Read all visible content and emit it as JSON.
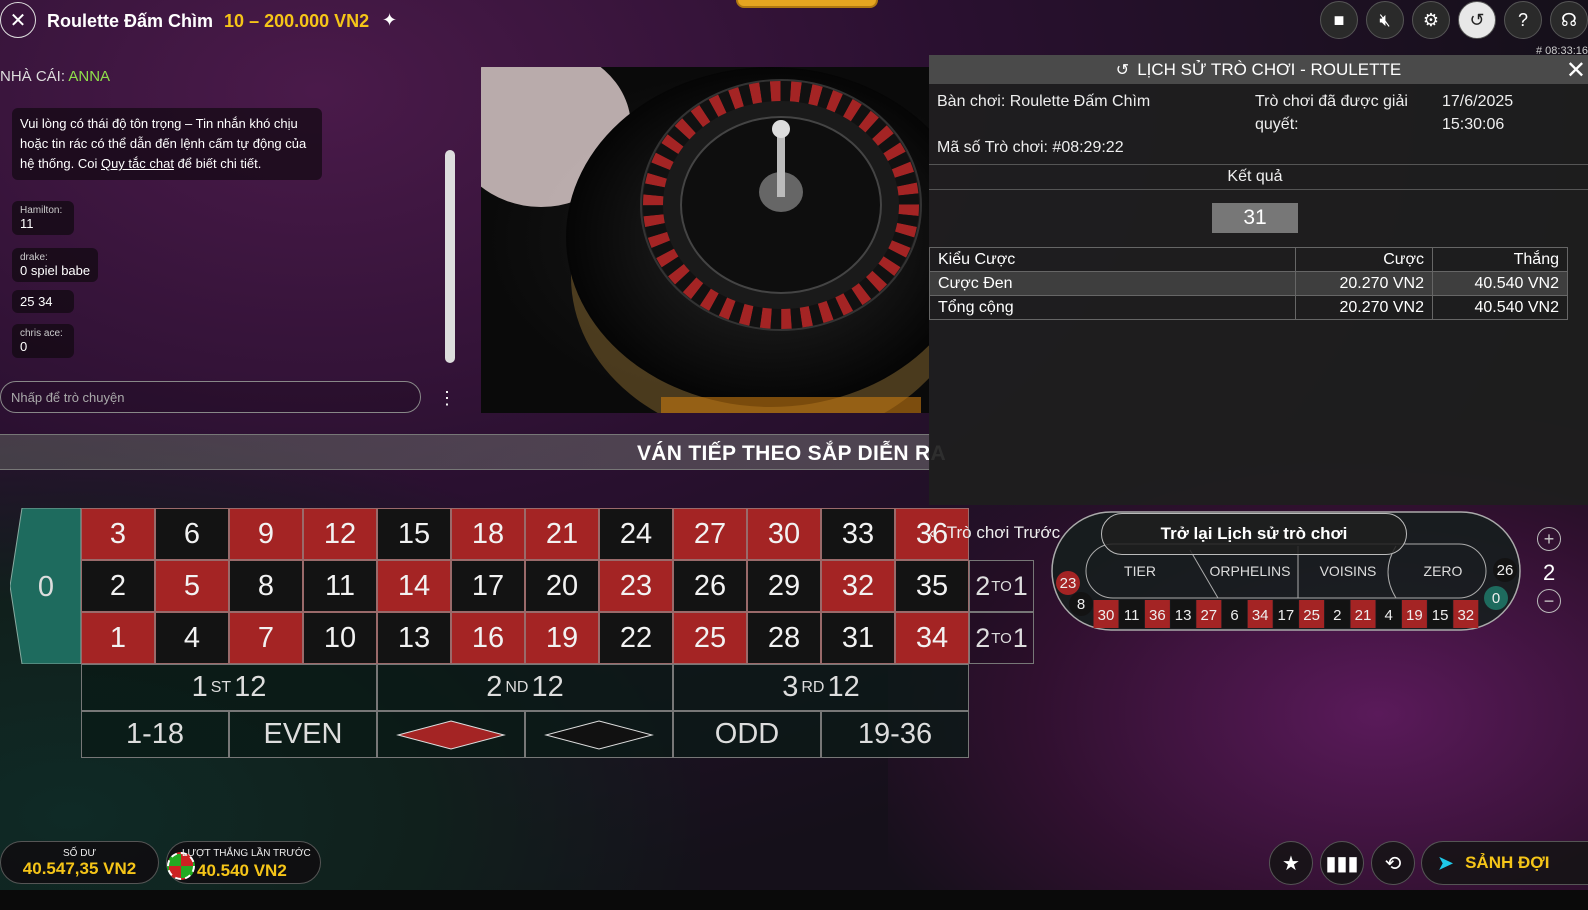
{
  "header": {
    "table_name": "Roulette Đấm Chìm",
    "limits": "10 – 200.000 VN2",
    "clock": "# 08:33:16"
  },
  "top_icons": [
    "video-icon",
    "mute-icon",
    "settings-icon",
    "history-icon",
    "help-icon",
    "headset-icon"
  ],
  "chat": {
    "dealer_label": "NHÀ CÁI:",
    "dealer_name": "ANNA",
    "notice_before": "Vui lòng có thái độ tôn trọng – Tin nhắn khó chịu hoặc tin rác có thể dẫn đến lệnh cấm tự động của hệ thống. Coi ",
    "notice_link": "Quy tắc chat",
    "notice_after": " để biết chi tiết.",
    "messages": [
      {
        "user": "Hamilton:",
        "text": "11"
      },
      {
        "user": "drake:",
        "text": "0 spiel babe"
      },
      {
        "user": "",
        "text": "25 34"
      },
      {
        "user": "chris ace:",
        "text": "0"
      }
    ],
    "input_placeholder": "Nhấp để trò chuyện"
  },
  "banner": "VÁN TIẾP THEO SẮP DIỄN RA",
  "board": {
    "zero": "0",
    "rows": [
      [
        "3",
        "6",
        "9",
        "12",
        "15",
        "18",
        "21",
        "24",
        "27",
        "30",
        "33",
        "36"
      ],
      [
        "2",
        "5",
        "8",
        "11",
        "14",
        "17",
        "20",
        "23",
        "26",
        "29",
        "32",
        "35"
      ],
      [
        "1",
        "4",
        "7",
        "10",
        "13",
        "16",
        "19",
        "22",
        "25",
        "28",
        "31",
        "34"
      ]
    ],
    "red_numbers": [
      "1",
      "3",
      "5",
      "7",
      "9",
      "12",
      "14",
      "16",
      "18",
      "19",
      "21",
      "23",
      "25",
      "27",
      "30",
      "32",
      "34",
      "36"
    ],
    "column_bet": {
      "left": "2",
      "sup": "TO",
      "right": "1"
    },
    "dozens": [
      {
        "num": "1",
        "sup": "ST",
        "val": "12"
      },
      {
        "num": "2",
        "sup": "ND",
        "val": "12"
      },
      {
        "num": "3",
        "sup": "RD",
        "val": "12"
      }
    ],
    "outside": [
      "1-18",
      "EVEN",
      "",
      "",
      "ODD",
      "19-36"
    ]
  },
  "history": {
    "title": "LỊCH SỬ TRÒ CHƠI - ROULETTE",
    "table_label": "Bàn chơi: Roulette Đấm Chìm",
    "resolved_label": "Trò chơi đã được giải quyết:",
    "date": "17/6/2025",
    "time": "15:30:06",
    "game_id": "Mã số Trò chơi: #08:29:22",
    "result_label": "Kết quả",
    "result": "31",
    "columns": [
      "Kiểu Cược",
      "Cược",
      "Thắng"
    ],
    "rows": [
      {
        "type": "Cược Đen",
        "bet": "20.270 VN2",
        "win": "40.540 VN2"
      },
      {
        "type": "Tổng cộng",
        "bet": "20.270 VN2",
        "win": "40.540 VN2"
      }
    ],
    "prev_game": "Trò chơi Trước",
    "back_button": "Trở lại Lịch sử trò chơi"
  },
  "racetrack": {
    "sections": [
      "TIER",
      "ORPHELINS",
      "VOISINS",
      "ZERO"
    ],
    "bottom_numbers": [
      "30",
      "11",
      "36",
      "13",
      "27",
      "6",
      "34",
      "17",
      "25",
      "2",
      "21",
      "4",
      "19",
      "15",
      "32"
    ],
    "left_numbers": [
      "23",
      "8"
    ],
    "right_numbers": [
      "26",
      "0"
    ],
    "side_value": "2"
  },
  "footer": {
    "balance_label": "SỐ DƯ",
    "balance": "40.547,35 VN2",
    "last_win_label": "LƯỢT THẮNG LẦN TRƯỚC",
    "last_win": "40.540 VN2",
    "lobby": "SẢNH ĐỢI"
  },
  "colors": {
    "red": "#a42424",
    "black": "#131313",
    "green": "#1e6b5e",
    "gold": "#f5c518",
    "dealer": "#8fe04a"
  }
}
